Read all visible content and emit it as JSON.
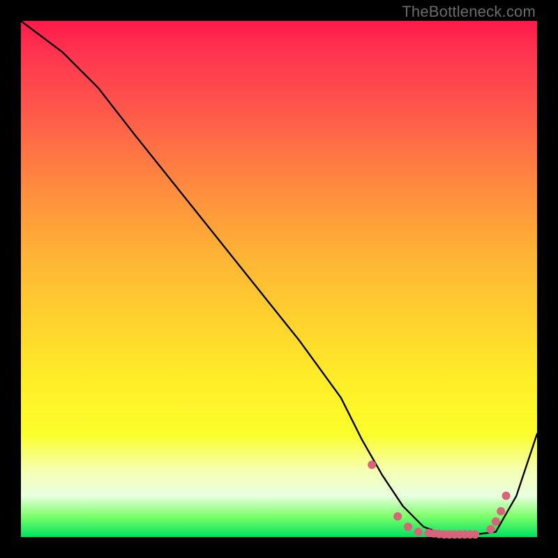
{
  "watermark": "TheBottleneck.com",
  "chart_data": {
    "type": "line",
    "title": "",
    "xlabel": "",
    "ylabel": "",
    "xlim": [
      0,
      100
    ],
    "ylim": [
      0,
      100
    ],
    "grid": false,
    "legend": false,
    "background": "rainbow-vertical-gradient",
    "series": [
      {
        "name": "curve",
        "color": "#000000",
        "x": [
          0,
          8,
          15,
          22,
          30,
          38,
          46,
          54,
          62,
          66,
          70,
          74,
          78,
          82,
          85,
          88,
          92,
          96,
          100
        ],
        "values": [
          100,
          94,
          87,
          78,
          68,
          58,
          48,
          38,
          27,
          19,
          12,
          6,
          2,
          0.5,
          0.5,
          0.5,
          1,
          8,
          20
        ]
      }
    ],
    "markers": {
      "name": "markers",
      "color": "#d9637a",
      "x": [
        68,
        73,
        75,
        77,
        79,
        80,
        81,
        82,
        83,
        84,
        85,
        86,
        87,
        88,
        91,
        92,
        93,
        94
      ],
      "values": [
        14,
        4,
        2,
        1,
        0.8,
        0.7,
        0.6,
        0.5,
        0.5,
        0.5,
        0.5,
        0.5,
        0.5,
        0.5,
        1.5,
        3,
        5,
        8
      ]
    }
  }
}
